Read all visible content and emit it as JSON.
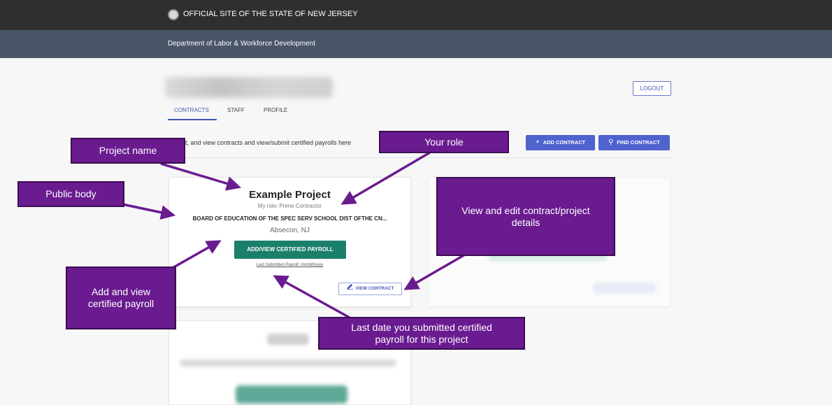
{
  "header": {
    "official_site": "OFFICIAL SITE OF THE STATE OF NEW JERSEY",
    "department": "Department of Labor & Workforce Development"
  },
  "account": {
    "logout_label": "LOGOUT"
  },
  "tabs": [
    {
      "label": "CONTRACTS",
      "active": true
    },
    {
      "label": "STAFF",
      "active": false
    },
    {
      "label": "PROFILE",
      "active": false
    }
  ],
  "contracts": {
    "intro_text": "dit, and view contracts and view/submit certified payrolls here",
    "add_contract_label": "ADD CONTRACT",
    "find_contract_label": "FIND CONTRACT"
  },
  "project_card": {
    "title": "Example Project",
    "role": "My role: Prime Contractor",
    "public_body": "BOARD OF EDUCATION OF THE SPEC SERV SCHOOL DIST OFTHE CN...",
    "location": "Absecon, NJ",
    "payroll_button": "ADD/VIEW CERTIFIED PAYROLL",
    "last_submitted": "Last Submitted Payroll: mm/dd/yyyy",
    "view_contract_label": "VIEW CONTRACT"
  },
  "callouts": {
    "project_name": "Project name",
    "public_body": "Public body",
    "your_role": "Your role",
    "view_edit": "View and edit contract/project details",
    "add_view_payroll": "Add and view certified payroll",
    "last_date": "Last date you submitted certified payroll for this project"
  },
  "colors": {
    "topbar": "#2f2f2f",
    "deptbar": "#4a5568",
    "accent_blue": "#4f63cf",
    "payroll_green": "#1a7f6b",
    "callout_purple": "#6a1b8f"
  },
  "icons": {
    "seal": "nj-state-seal",
    "add": "plus-icon",
    "find": "search-icon",
    "edit": "pencil-icon"
  }
}
